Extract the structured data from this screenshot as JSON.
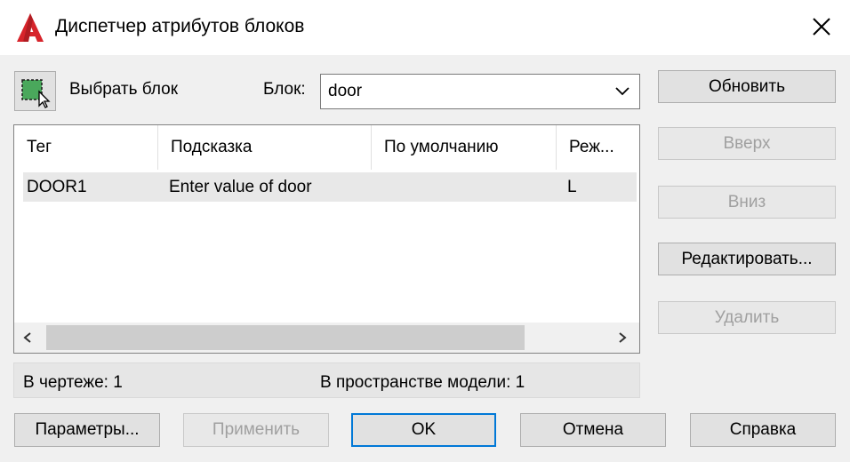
{
  "window": {
    "title": "Диспетчер атрибутов блоков",
    "app_icon": "autocad-logo-icon",
    "close_icon": "close-icon"
  },
  "toolbar": {
    "select_block_label": "Выбрать блок",
    "block_label": "Блок:",
    "block_value": "door"
  },
  "table": {
    "columns": [
      "Тег",
      "Подсказка",
      "По умолчанию",
      "Реж..."
    ],
    "rows": [
      {
        "tag": "DOOR1",
        "prompt": "Enter value of door",
        "default": "",
        "mode": "L"
      }
    ]
  },
  "status": {
    "in_drawing": "В чертеже: 1",
    "in_model_space": "В пространстве модели: 1"
  },
  "side_buttons": {
    "sync": "Обновить",
    "up": "Вверх",
    "down": "Вниз",
    "edit": "Редактировать...",
    "remove": "Удалить"
  },
  "bottom_buttons": {
    "settings": "Параметры...",
    "apply": "Применить",
    "ok": "OK",
    "cancel": "Отмена",
    "help": "Справка"
  },
  "colors": {
    "accent": "#0078d7",
    "logo_red": "#d7242b"
  }
}
